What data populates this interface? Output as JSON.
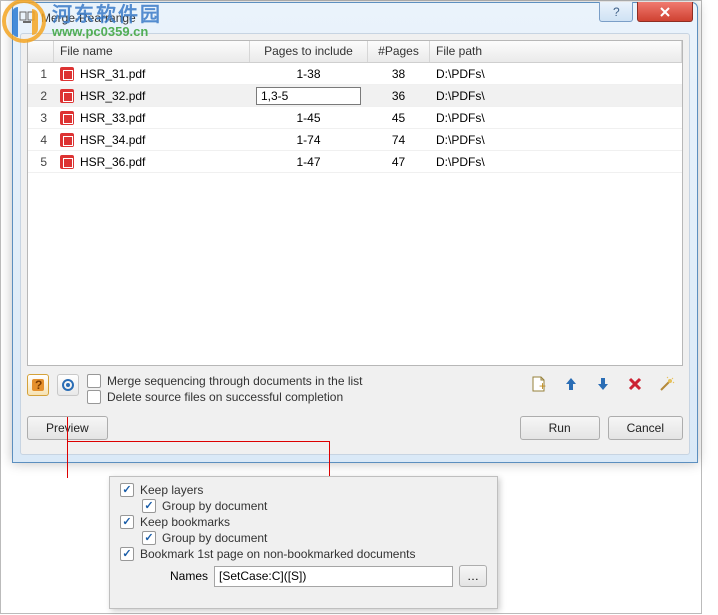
{
  "watermark": {
    "cn": "河东软件园",
    "url": "www.pc0359.cn"
  },
  "window": {
    "title": "Merge-Rearrange"
  },
  "grid": {
    "headers": {
      "rownum": "",
      "filename": "File name",
      "pages": "Pages to include",
      "npages": "#Pages",
      "path": "File path"
    },
    "rows": [
      {
        "n": "1",
        "name": "HSR_31.pdf",
        "pages": "1-38",
        "npages": "38",
        "path": "D:\\PDFs\\",
        "editing": false
      },
      {
        "n": "2",
        "name": "HSR_32.pdf",
        "pages": "1,3-5",
        "npages": "36",
        "path": "D:\\PDFs\\",
        "editing": true
      },
      {
        "n": "3",
        "name": "HSR_33.pdf",
        "pages": "1-45",
        "npages": "45",
        "path": "D:\\PDFs\\",
        "editing": false
      },
      {
        "n": "4",
        "name": "HSR_34.pdf",
        "pages": "1-74",
        "npages": "74",
        "path": "D:\\PDFs\\",
        "editing": false
      },
      {
        "n": "5",
        "name": "HSR_36.pdf",
        "pages": "1-47",
        "npages": "47",
        "path": "D:\\PDFs\\",
        "editing": false
      }
    ]
  },
  "options": {
    "merge_seq": "Merge sequencing through documents in the list",
    "delete_src": "Delete source files on successful completion"
  },
  "buttons": {
    "preview": "Preview",
    "run": "Run",
    "cancel": "Cancel"
  },
  "popup": {
    "keep_layers": "Keep layers",
    "group_by_doc": "Group by document",
    "keep_bookmarks": "Keep bookmarks",
    "bookmark_first": "Bookmark 1st page on non-bookmarked documents",
    "names_label": "Names",
    "names_value": "[SetCase:C]([S])"
  },
  "icons": {
    "help": "?",
    "close": "X",
    "add_page": "add-page",
    "up": "↑",
    "down": "↓",
    "remove": "✖",
    "settings": "⚙"
  }
}
